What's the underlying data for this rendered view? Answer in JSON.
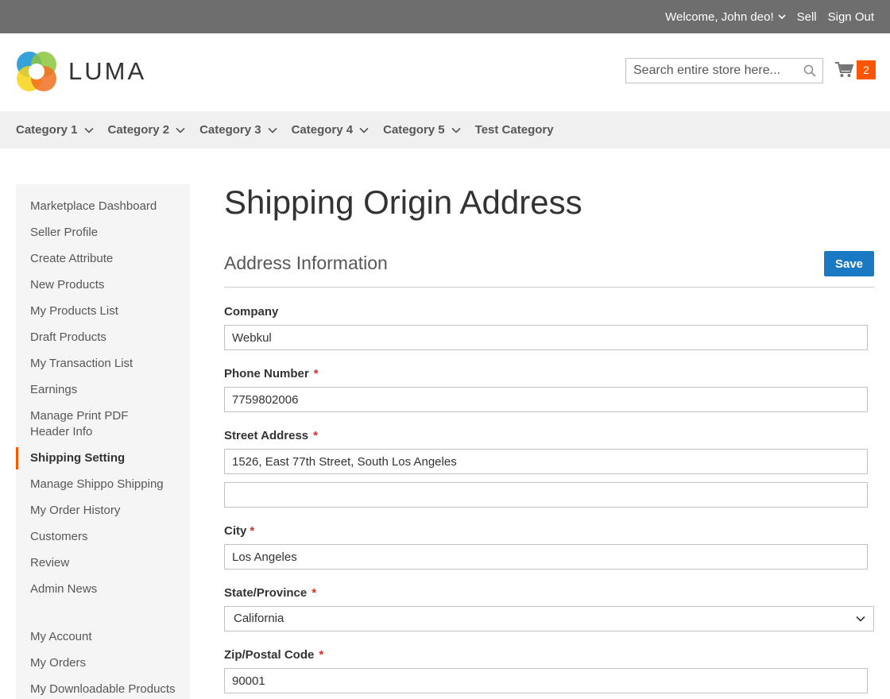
{
  "topbar": {
    "welcome": "Welcome, John deo!",
    "sell": "Sell",
    "sign_out": "Sign Out"
  },
  "header": {
    "logo_text": "LUMA",
    "search_placeholder": "Search entire store here...",
    "cart_count": "2"
  },
  "nav": {
    "items": [
      {
        "label": "Category 1",
        "has_dropdown": true
      },
      {
        "label": "Category 2",
        "has_dropdown": true
      },
      {
        "label": "Category 3",
        "has_dropdown": true
      },
      {
        "label": "Category 4",
        "has_dropdown": true
      },
      {
        "label": "Category 5",
        "has_dropdown": true
      },
      {
        "label": "Test Category",
        "has_dropdown": false
      }
    ]
  },
  "sidebar": {
    "items": [
      "Marketplace Dashboard",
      "Seller Profile",
      "Create Attribute",
      "New Products",
      "My Products List",
      "Draft Products",
      "My Transaction List",
      "Earnings",
      "Manage Print PDF Header Info",
      "Shipping Setting",
      "Manage Shippo Shipping",
      "My Order History",
      "Customers",
      "Review",
      "Admin News"
    ],
    "active_item": "Shipping Setting",
    "account_items": [
      "My Account",
      "My Orders",
      "My Downloadable Products"
    ]
  },
  "main": {
    "page_title": "Shipping Origin Address",
    "section_title": "Address Information",
    "save_label": "Save",
    "fields": {
      "company": {
        "label": "Company",
        "value": "Webkul"
      },
      "phone": {
        "label": "Phone Number",
        "value": "7759802006"
      },
      "street": {
        "label": "Street Address",
        "value": "1526, East 77th Street, South Los Angeles",
        "value2": ""
      },
      "city": {
        "label": "City",
        "value": "Los Angeles"
      },
      "state": {
        "label": "State/Province",
        "value": "California"
      },
      "zip": {
        "label": "Zip/Postal Code",
        "value": "90001"
      }
    },
    "required_marker": "*"
  },
  "colors": {
    "accent": "#ff5501",
    "primary_button": "#1979c3",
    "topbar_bg": "#6e6e6e",
    "nav_bg": "#f0f0f0",
    "required": "#e02b27"
  },
  "icons": {
    "search": "search-icon",
    "cart": "cart-icon",
    "dropdown": "chevron-down-icon"
  }
}
